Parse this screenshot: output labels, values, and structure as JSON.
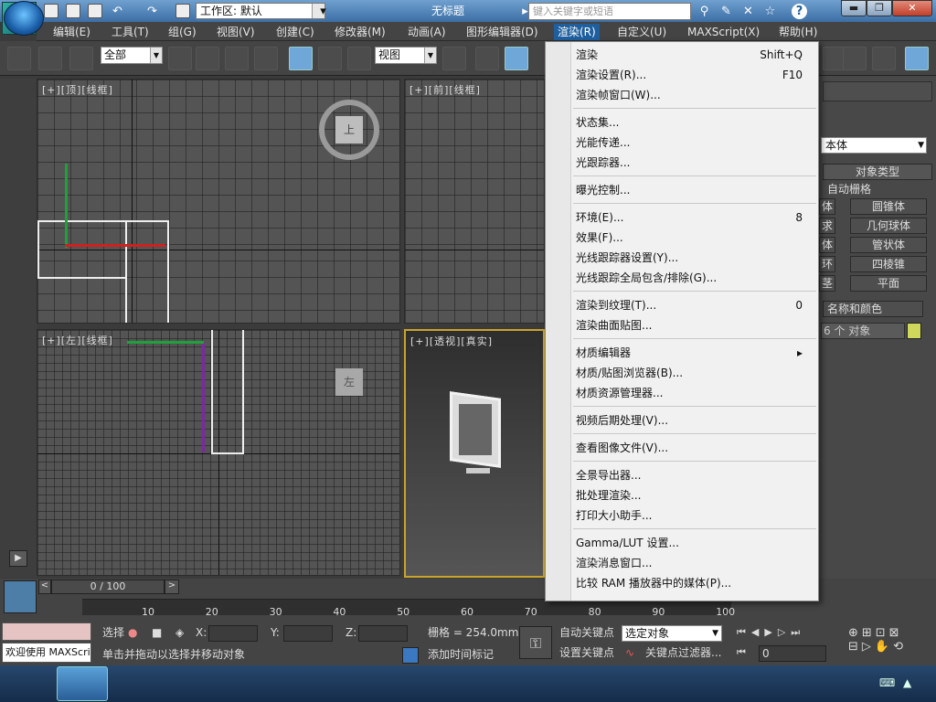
{
  "title_bar": {
    "workspace_label": "工作区: 默认",
    "doc_title": "无标题",
    "search_placeholder": "键入关键字或短语"
  },
  "menu_bar": [
    {
      "label": "编辑(E)"
    },
    {
      "label": "工具(T)"
    },
    {
      "label": "组(G)"
    },
    {
      "label": "视图(V)"
    },
    {
      "label": "创建(C)"
    },
    {
      "label": "修改器(M)"
    },
    {
      "label": "动画(A)"
    },
    {
      "label": "图形编辑器(D)"
    },
    {
      "label": "渲染(R)",
      "active": true
    },
    {
      "label": "自定义(U)"
    },
    {
      "label": "MAXScript(X)"
    },
    {
      "label": "帮助(H)"
    }
  ],
  "toolbar": {
    "filter_select": "全部",
    "coord_select": "视图"
  },
  "viewports": {
    "top": "[+][顶][线框]",
    "front": "[+][前][线框]",
    "left": "[+][左][线框]",
    "persp_plus": "[+]",
    "persp_view": "[透视]",
    "persp_shade": "[真实]",
    "view_cube_top": "上",
    "view_cube_left": "左"
  },
  "render_menu": {
    "groups": [
      [
        {
          "label": "渲染",
          "shortcut": "Shift+Q"
        },
        {
          "label": "渲染设置(R)...",
          "shortcut": "F10"
        },
        {
          "label": "渲染帧窗口(W)...",
          "shortcut": ""
        }
      ],
      [
        {
          "label": "状态集...",
          "shortcut": ""
        },
        {
          "label": "光能传递...",
          "shortcut": ""
        },
        {
          "label": "光跟踪器...",
          "shortcut": ""
        }
      ],
      [
        {
          "label": "曝光控制...",
          "shortcut": ""
        }
      ],
      [
        {
          "label": "环境(E)...",
          "shortcut": "8"
        },
        {
          "label": "效果(F)...",
          "shortcut": ""
        },
        {
          "label": "光线跟踪器设置(Y)...",
          "shortcut": ""
        },
        {
          "label": "光线跟踪全局包含/排除(G)...",
          "shortcut": ""
        }
      ],
      [
        {
          "label": "渲染到纹理(T)...",
          "shortcut": "0"
        },
        {
          "label": "渲染曲面贴图...",
          "shortcut": ""
        }
      ],
      [
        {
          "label": "材质编辑器",
          "shortcut": "▸"
        },
        {
          "label": "材质/贴图浏览器(B)...",
          "shortcut": ""
        },
        {
          "label": "材质资源管理器...",
          "shortcut": ""
        }
      ],
      [
        {
          "label": "视频后期处理(V)...",
          "shortcut": ""
        }
      ],
      [
        {
          "label": "查看图像文件(V)...",
          "shortcut": ""
        }
      ],
      [
        {
          "label": "全景导出器...",
          "shortcut": ""
        },
        {
          "label": "批处理渲染...",
          "shortcut": ""
        },
        {
          "label": "打印大小助手...",
          "shortcut": ""
        }
      ],
      [
        {
          "label": "Gamma/LUT 设置...",
          "shortcut": ""
        },
        {
          "label": "渲染消息窗口...",
          "shortcut": ""
        },
        {
          "label": "比较 RAM 播放器中的媒体(P)...",
          "shortcut": ""
        }
      ]
    ]
  },
  "command_panel": {
    "dropdown": "本体",
    "section_object_type": "对象类型",
    "autogrid": "自动栅格",
    "buttons": [
      [
        "体",
        "圆锥体"
      ],
      [
        "求",
        "几何球体"
      ],
      [
        "体",
        "管状体"
      ],
      [
        "环",
        "四棱锥"
      ],
      [
        "茎",
        "平面"
      ]
    ],
    "section_name_color": "名称和颜色",
    "object_name": "6 个 对象"
  },
  "timeline": {
    "frame": "0 / 100",
    "ticks": [
      "10",
      "20",
      "30",
      "40",
      "50",
      "60",
      "70",
      "80",
      "90",
      "100"
    ]
  },
  "status": {
    "maxscript_listener": "欢迎使用 MAXScri",
    "selected_label": "选择",
    "prompt": "单击并拖动以选择并移动对象",
    "x_label": "X:",
    "y_label": "Y:",
    "z_label": "Z:",
    "grid_label": "栅格 = 254.0mm",
    "add_time_tag": "添加时间标记",
    "auto_key": "自动关键点",
    "set_key": "设置关键点",
    "key_select": "选定对象",
    "key_filters": "关键点过滤器...",
    "frame_field": "0"
  },
  "colors": {
    "accent": "#1f5f9e",
    "swatch": "#cfd85a"
  }
}
